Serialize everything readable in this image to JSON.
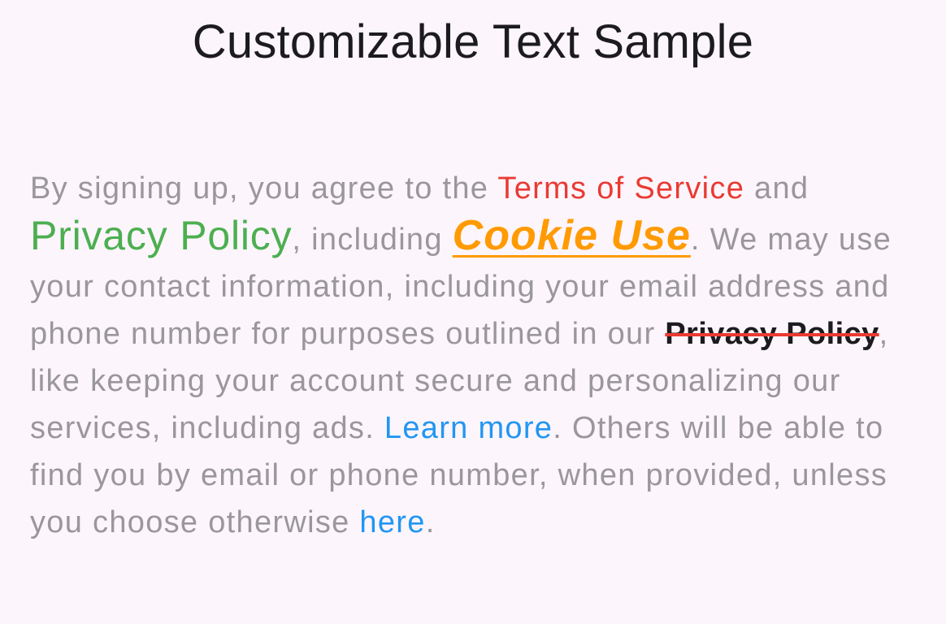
{
  "header": {
    "title": "Customizable Text Sample"
  },
  "paragraph": {
    "text_1": "By signing up, you agree to the ",
    "terms_link": "Terms of Service",
    "text_2": " and ",
    "privacy_link": "Privacy Policy",
    "text_3": ", including ",
    "cookie_link": "Cookie Use",
    "text_4": ". We may use your contact information, including your email address and phone number for purposes outlined in our ",
    "privacy_strike_link": "Privacy Policy",
    "text_5": ", like keeping your account secure and personalizing our services, including ads. ",
    "learn_more_link": "Learn more",
    "text_6": ". Others will be able to find you by email or phone number, when provided, unless you choose otherwise ",
    "here_link": "here",
    "text_7": "."
  },
  "colors": {
    "background": "#fcf5fc",
    "title": "#1c1b1f",
    "body_text": "#9a979c",
    "terms_link": "#ea3a32",
    "privacy_link": "#4caf50",
    "cookie_link": "#ff9a00",
    "strike_line": "#ea3a32",
    "blue_link": "#2196f3"
  }
}
